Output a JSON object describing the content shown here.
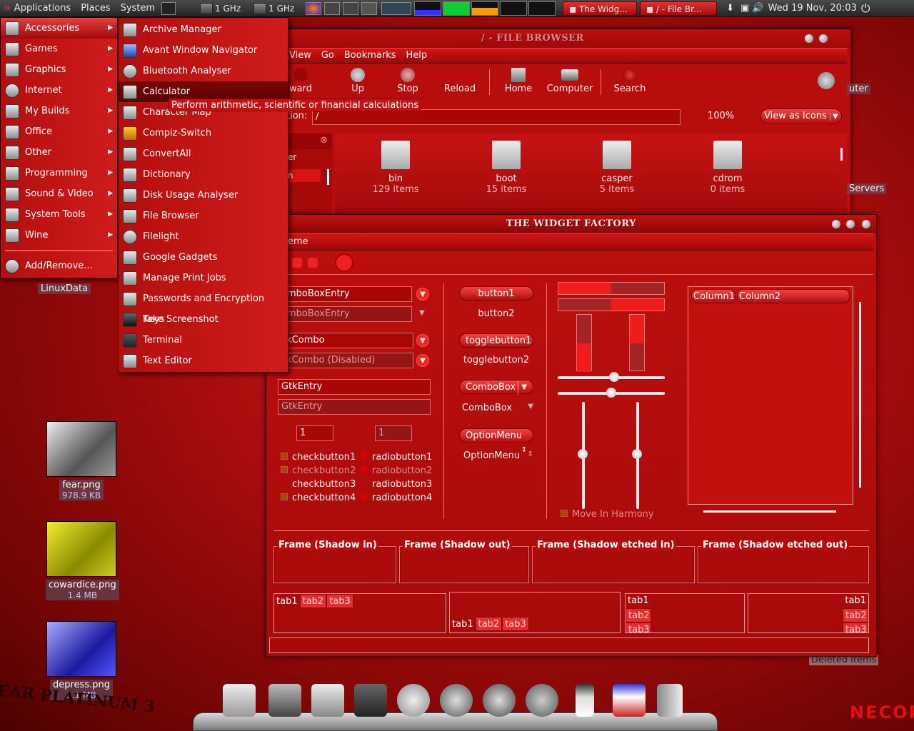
{
  "panel": {
    "menus": [
      "Applications",
      "Places",
      "System"
    ],
    "cpu": [
      "1 GHz",
      "1 GHz"
    ],
    "tasks": [
      "The Widg...",
      "/ - File Br..."
    ],
    "clock": "Wed 19 Nov, 20:03"
  },
  "appmenu": {
    "items": [
      "Accessories",
      "Games",
      "Graphics",
      "Internet",
      "My Builds",
      "Office",
      "Other",
      "Programming",
      "Sound & Video",
      "System Tools",
      "Wine"
    ],
    "addremove": "Add/Remove..."
  },
  "submenu": {
    "items": [
      "Archive Manager",
      "Avant Window Navigator",
      "Bluetooth Analyser",
      "Calculator",
      "Character Map",
      "Compiz-Switch",
      "ConvertAll",
      "Dictionary",
      "Disk Usage Analyser",
      "File Browser",
      "Filelight",
      "Google Gadgets",
      "Manage Print Jobs",
      "Passwords and Encryption Keys",
      "Take Screenshot",
      "Terminal",
      "Text Editor"
    ],
    "tooltip": "Perform arithmetic, scientific or financial calculations"
  },
  "filebrowser": {
    "title": "/ - FILE BROWSER",
    "menus": [
      "View",
      "Go",
      "Bookmarks",
      "Help"
    ],
    "toolbar": [
      "ward",
      "Up",
      "Stop",
      "Reload",
      "Home",
      "Computer",
      "Search"
    ],
    "location_label": "tion:",
    "location_value": "/",
    "zoom": "100%",
    "view": "View as Icons",
    "side": [
      "er",
      "n"
    ],
    "folders": [
      {
        "name": "bin",
        "count": "129 items"
      },
      {
        "name": "boot",
        "count": "15 items"
      },
      {
        "name": "casper",
        "count": "5 items"
      },
      {
        "name": "cdrom",
        "count": "0 items"
      }
    ]
  },
  "widgetfactory": {
    "title": "THE WIDGET FACTORY",
    "menu": "eme",
    "combos": [
      "omboBoxEntry",
      "omboBoxEntry",
      "ckCombo",
      "ckCombo (Disabled)"
    ],
    "entries": [
      "GtkEntry",
      "GtkEntry"
    ],
    "spin": [
      "1",
      "1"
    ],
    "checks": [
      "checkbutton1",
      "checkbutton2",
      "checkbutton3",
      "checkbutton4"
    ],
    "radios": [
      "radiobutton1",
      "radiobutton2",
      "radiobutton3",
      "radiobutton4"
    ],
    "buttons": [
      "button1",
      "button2",
      "togglebutton1",
      "togglebutton2",
      "ComboBox",
      "ComboBox",
      "OptionMenu",
      "OptionMenu"
    ],
    "harmony": "Move In Harmony",
    "columns": [
      "Column1",
      "Column2"
    ],
    "frames": [
      "Frame (Shadow in)",
      "Frame (Shadow out)",
      "Frame (Shadow etched in)",
      "Frame (Shadow etched out)"
    ],
    "tabs": [
      "tab1",
      "tab2",
      "tab3"
    ]
  },
  "desktop": {
    "linuxdata": "LinuxData",
    "servers": "Servers",
    "computer": "uter",
    "deleted": "Deleted Items",
    "files": [
      {
        "name": "fear.png",
        "size": "978.9 KB"
      },
      {
        "name": "cowardice.png",
        "size": "1.4 MB"
      },
      {
        "name": "depress.png",
        "size": "1.1 MB"
      }
    ],
    "wallpaper_left": "EAR PLATINUM 3",
    "wallpaper_right": "NECOP"
  }
}
